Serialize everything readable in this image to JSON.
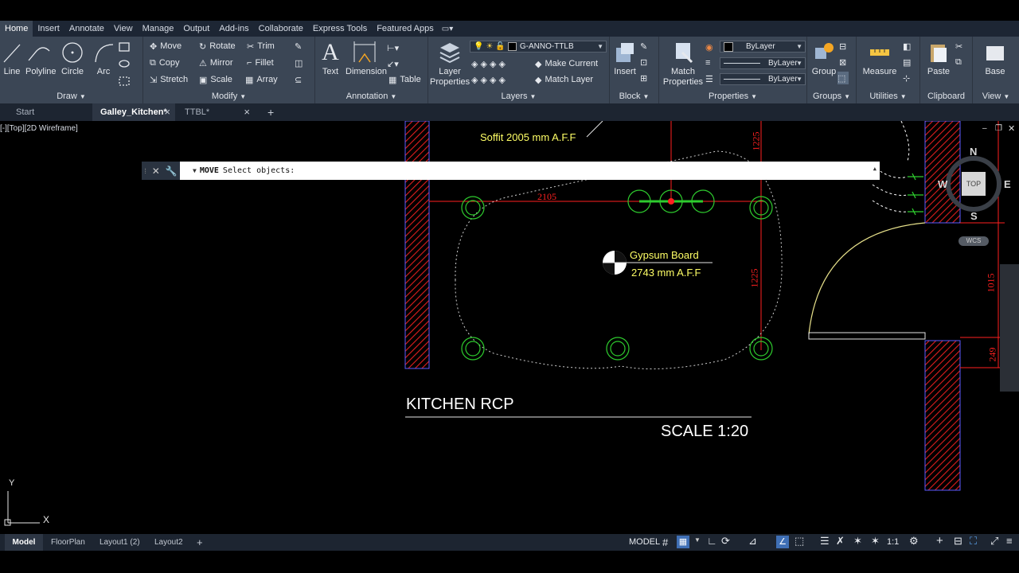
{
  "ribbon_tabs": [
    "Home",
    "Insert",
    "Annotate",
    "View",
    "Manage",
    "Output",
    "Add-ins",
    "Collaborate",
    "Express Tools",
    "Featured Apps"
  ],
  "active_tab": "Home",
  "menu_extra": "▭▾",
  "draw_panel": {
    "title": "Draw",
    "line": "Line",
    "polyline": "Polyline",
    "circle": "Circle",
    "arc": "Arc"
  },
  "modify_panel": {
    "title": "Modify",
    "move": "Move",
    "rotate": "Rotate",
    "trim": "Trim",
    "copy": "Copy",
    "mirror": "Mirror",
    "fillet": "Fillet",
    "stretch": "Stretch",
    "scale": "Scale",
    "array": "Array"
  },
  "annotation_panel": {
    "title": "Annotation",
    "text": "Text",
    "dimension": "Dimension",
    "table": "Table"
  },
  "layers_panel": {
    "title": "Layers",
    "layer_properties": "Layer Properties",
    "current_layer": "G-ANNO-TTLB",
    "make_current": "Make Current",
    "match_layer": "Match Layer"
  },
  "block_panel": {
    "title": "Block",
    "insert": "Insert"
  },
  "properties_panel": {
    "title": "Properties",
    "match_properties": "Match Properties",
    "color": "ByLayer",
    "linetype": "ByLayer",
    "lineweight": "ByLayer"
  },
  "groups_panel": {
    "title": "Groups",
    "group": "Group"
  },
  "utilities_panel": {
    "title": "Utilities",
    "measure": "Measure"
  },
  "clipboard_panel": {
    "title": "Clipboard",
    "paste": "Paste"
  },
  "view_panel": {
    "title": "View",
    "base": "Base"
  },
  "doc_tabs": {
    "start": "Start",
    "active": "Galley_Kitchen*",
    "other": "TTBL*",
    "add": "+"
  },
  "viewport": {
    "label": "[-][Top][2D Wireframe]"
  },
  "command_line": {
    "command": "MOVE",
    "prompt": "Select objects:"
  },
  "drawing": {
    "soffit_note": "Soffit 2005 mm A.F.F",
    "dim_top": "2105",
    "dim_1225_top": "1225",
    "dim_1225": "1225",
    "dim_1015": "1015",
    "dim_249": "249",
    "tag_material": "Gypsum Board",
    "tag_height": "2743 mm A.F.F",
    "title": "KITCHEN RCP",
    "scale": "SCALE 1:20",
    "line_color": "#ff2020",
    "fixture_color": "#2ecc2e",
    "annotation_color": "#ffff66"
  },
  "viewcube": {
    "n": "N",
    "s": "S",
    "e": "E",
    "w": "W",
    "top": "TOP",
    "wcs": "WCS"
  },
  "ucs": {
    "y": "Y",
    "x": "X"
  },
  "layout_tabs": [
    "Model",
    "FloorPlan",
    "Layout1 (2)",
    "Layout2"
  ],
  "layout_add": "+",
  "status": {
    "model": "MODEL",
    "scale": "1:1"
  }
}
